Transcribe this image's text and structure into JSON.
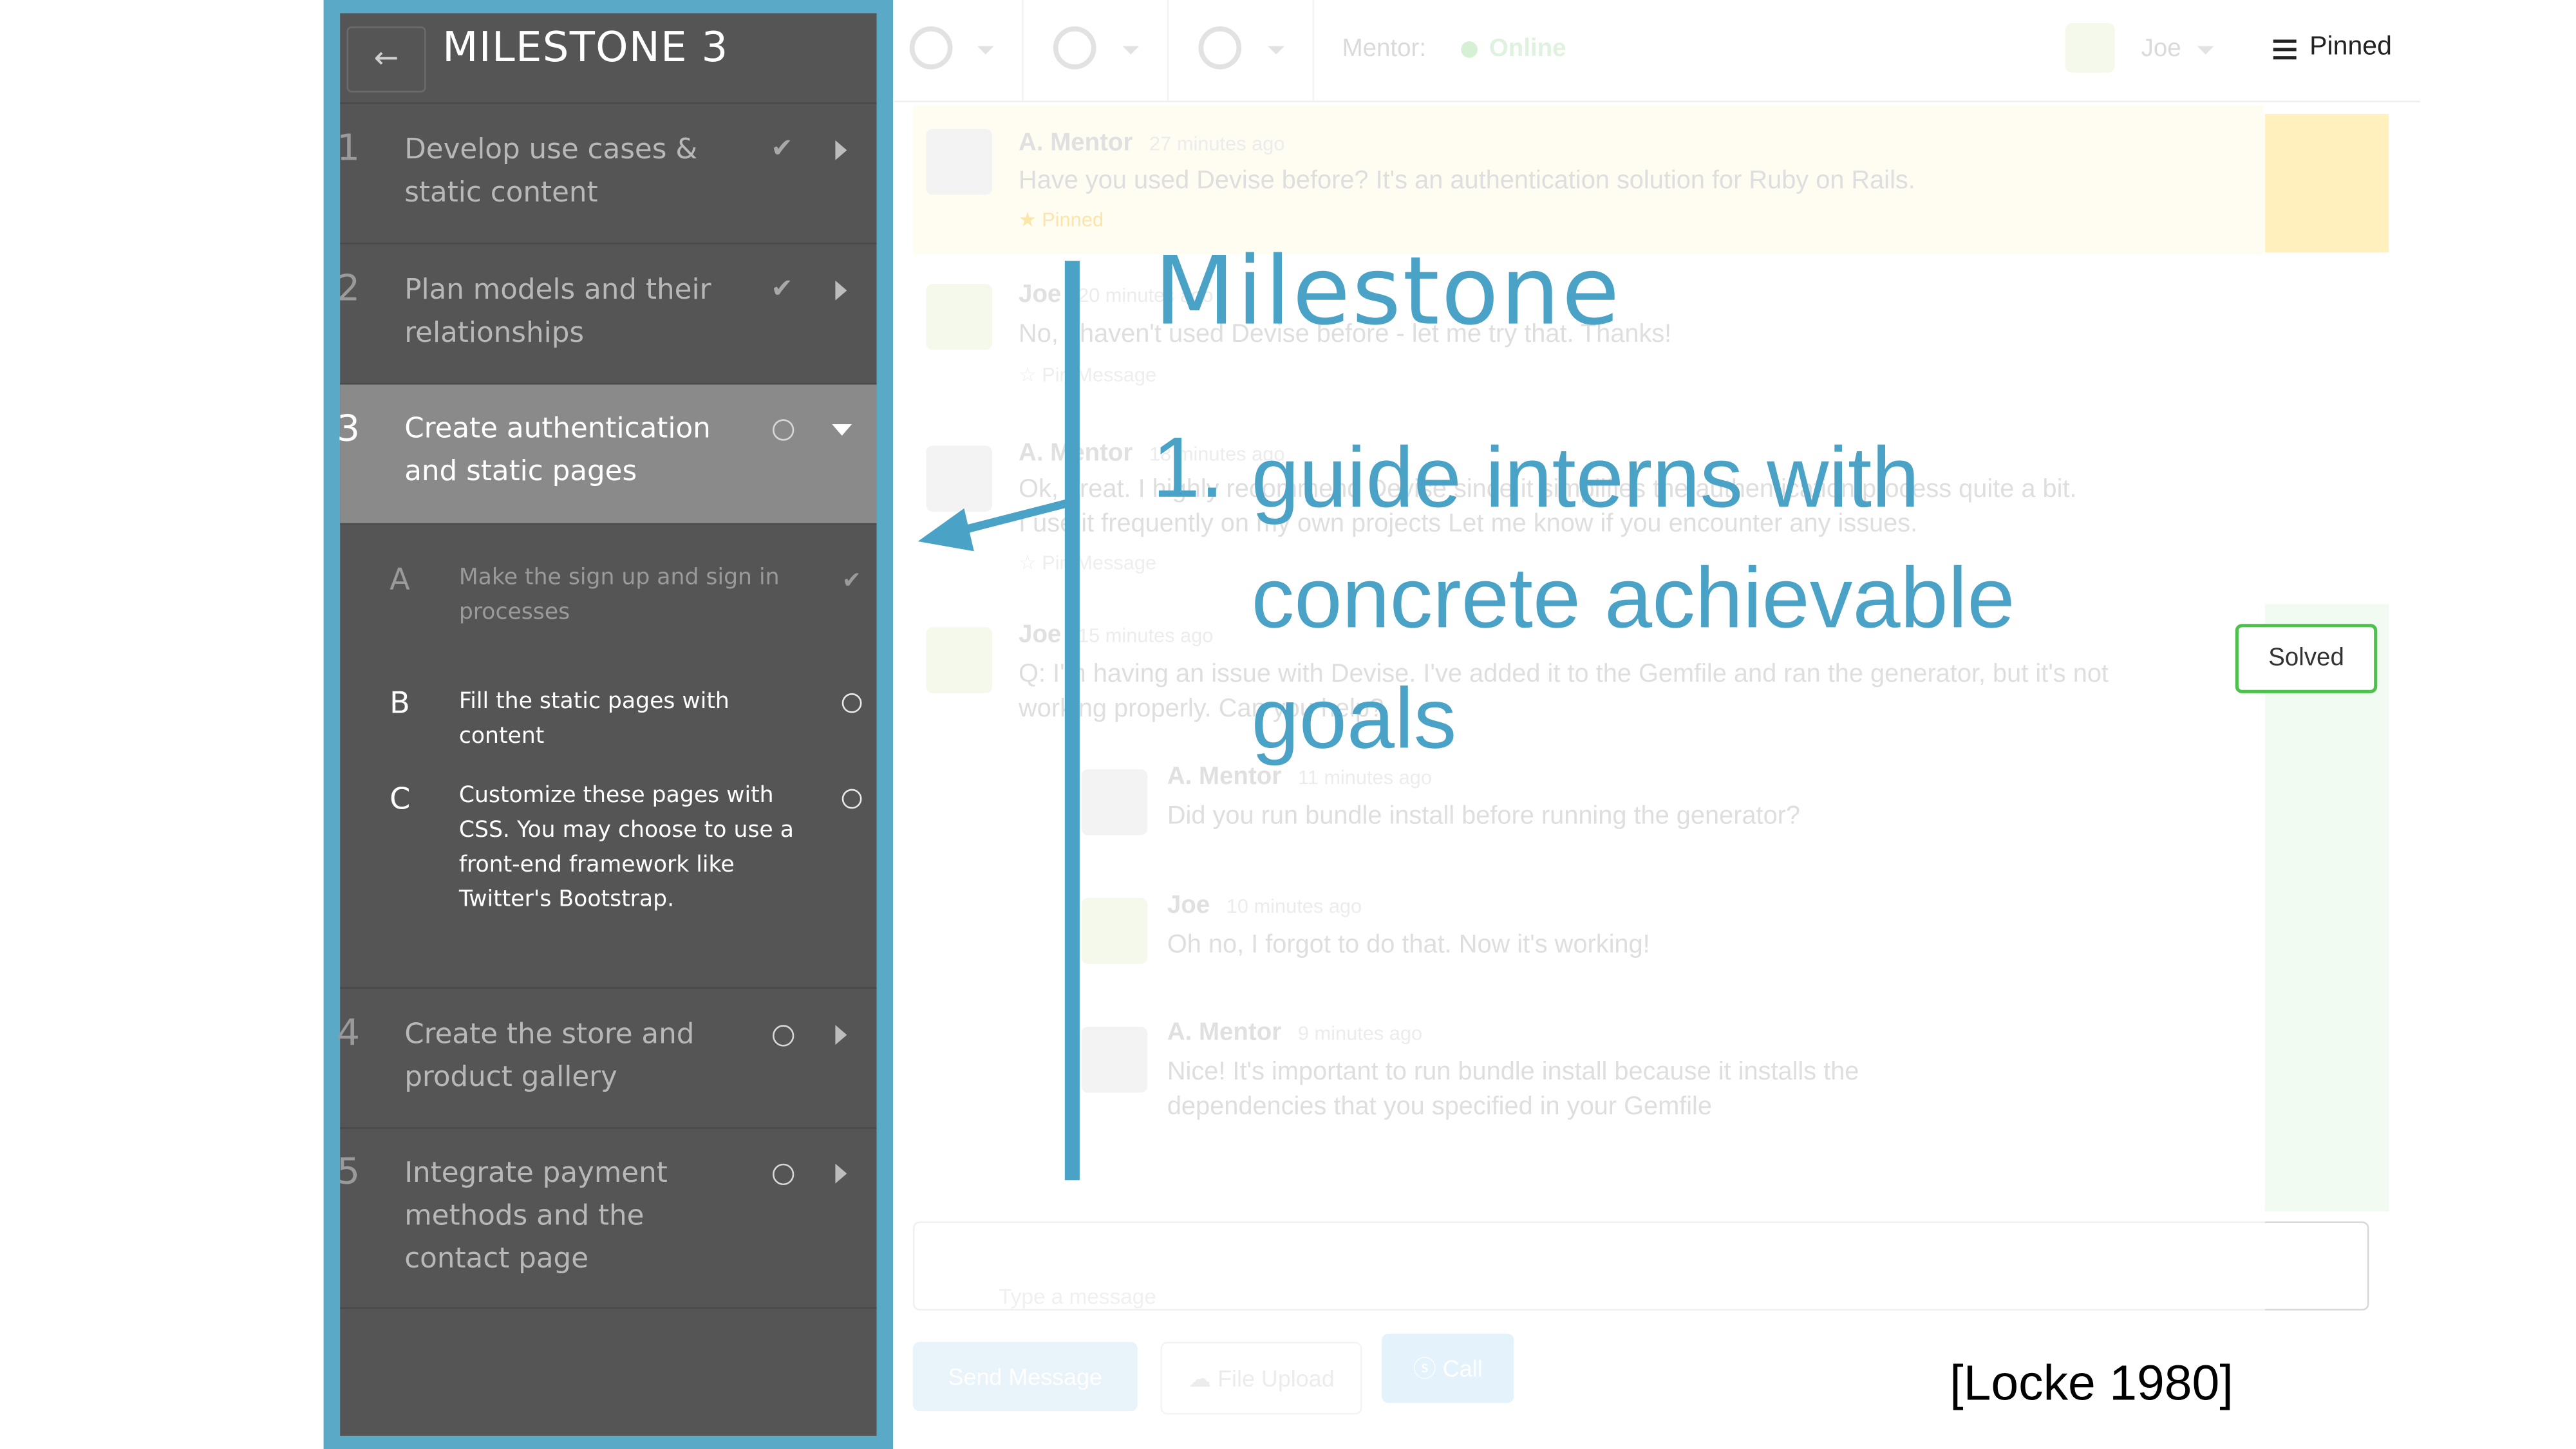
{
  "sidebar": {
    "back_label": "←",
    "title": "MILESTONE 3",
    "milestones": [
      {
        "number": "1",
        "label": "Develop use cases & static content",
        "status": "done"
      },
      {
        "number": "2",
        "label": "Plan models and their relationships",
        "status": "done"
      },
      {
        "number": "3",
        "label": "Create authentication and static pages",
        "status": "current"
      },
      {
        "number": "4",
        "label": "Create the store and product gallery",
        "status": "todo"
      },
      {
        "number": "5",
        "label": "Integrate payment methods and the contact page",
        "status": "todo"
      }
    ],
    "subtasks": [
      {
        "letter": "A",
        "label": "Make the sign up and sign in processes",
        "status": "done"
      },
      {
        "letter": "B",
        "label": "Fill the static pages with content",
        "status": "todo"
      },
      {
        "letter": "C",
        "label": "Customize these pages with CSS. You may choose to use a front-end framework like Twitter's Bootstrap.",
        "status": "todo"
      }
    ],
    "colors": {
      "frame": "#5aa9c6",
      "panel": "#555555",
      "active": "#8a8a8a"
    }
  },
  "topbar": {
    "mentor_label": "Mentor:",
    "mentor_status": "Online",
    "user_name": "Joe",
    "pinned_label": "Pinned",
    "icons": [
      "clock-icon",
      "github-icon",
      "help-icon"
    ]
  },
  "messages": [
    {
      "author": "A. Mentor",
      "time": "27 minutes ago",
      "text": "Have you used Devise before? It's an authentication solution for Ruby on Rails.",
      "pin_label": "Pinned",
      "pinned": true
    },
    {
      "author": "Joe",
      "time": "20 minutes ago",
      "text": "No, I haven't used Devise before - let me try that. Thanks!",
      "pin_label": "Pin Message",
      "pinned": false
    },
    {
      "author": "A. Mentor",
      "time": "18 minutes ago",
      "text": "Ok, great. I highly recommend Devise since it simplifies the authentication process quite a bit.",
      "text2": "I use it frequently on my own projects Let me know if you encounter any issues.",
      "pin_label": "Pin Message",
      "pinned": false
    },
    {
      "author": "Joe",
      "time": "15 minutes ago",
      "text": "Q: I'm having an issue with Devise. I've added it to the Gemfile and ran the generator, but it's not",
      "text2": "working properly. Can you help?"
    },
    {
      "author": "A. Mentor",
      "time": "11 minutes ago",
      "text": "Did you run bundle install before running the generator?"
    },
    {
      "author": "Joe",
      "time": "10 minutes ago",
      "text": "Oh no, I forgot to do that. Now it's working!"
    },
    {
      "author": "A. Mentor",
      "time": "9 minutes ago",
      "text": "Nice! It's important to run bundle install because it installs the",
      "text2": "dependencies that you specified in your Gemfile"
    }
  ],
  "solved_label": "Solved",
  "composer": {
    "placeholder": "Type a message",
    "send_label": "Send Message",
    "upload_label": "File Upload",
    "call_label": "Call"
  },
  "annotation": {
    "title": "Milestone",
    "number": "1.",
    "body": "guide interns with concrete achievable goals",
    "citation": "[Locke 1980]",
    "color": "#4aa3c6"
  }
}
